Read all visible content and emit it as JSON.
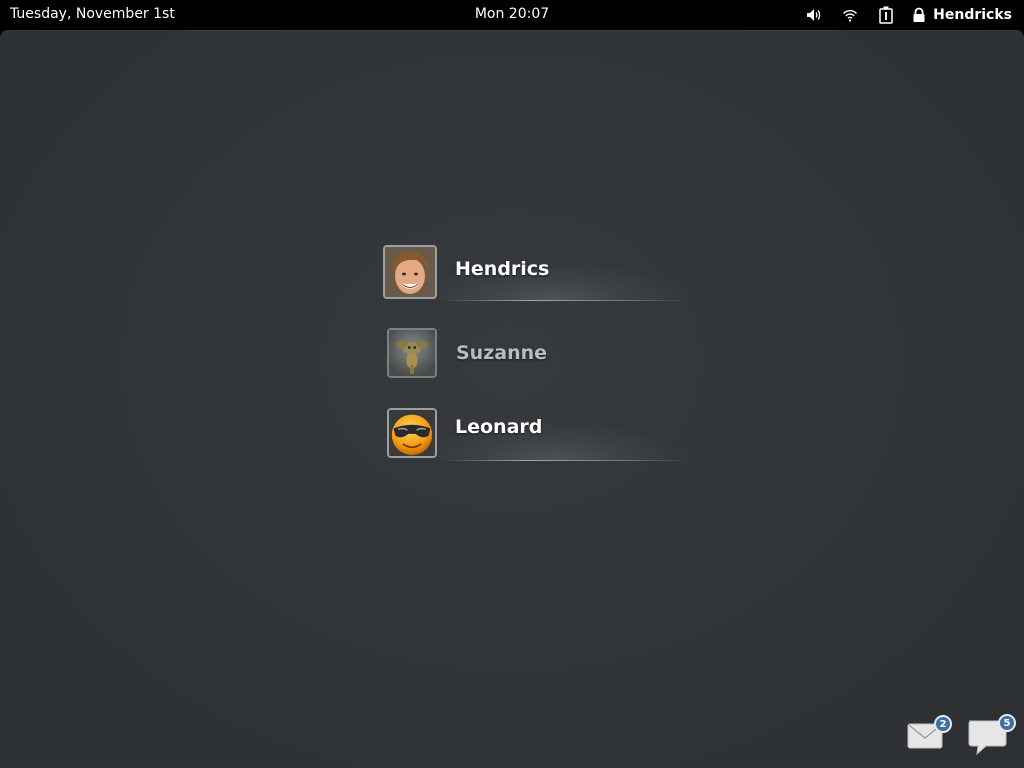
{
  "topbar": {
    "date": "Tuesday, November 1st",
    "clock": "Mon 20:07",
    "tray": {
      "icons": [
        "volume-icon",
        "wifi-icon",
        "accessibility-icon"
      ],
      "user": "Hendricks",
      "user_icon": "lock-icon"
    }
  },
  "users": [
    {
      "name": "Hendrics",
      "avatar": "face-photo",
      "selected": true
    },
    {
      "name": "Suzanne",
      "avatar": "creature",
      "selected": false
    },
    {
      "name": "Leonard",
      "avatar": "sunglasses-smiley",
      "selected": true
    }
  ],
  "notifications": [
    {
      "icon": "mail-icon",
      "count": "2"
    },
    {
      "icon": "chat-icon",
      "count": "5"
    }
  ],
  "colors": {
    "background": "#303437",
    "badge": "#3d6fa8",
    "text": "#ffffff",
    "dim_text": "#b9bcbe"
  }
}
